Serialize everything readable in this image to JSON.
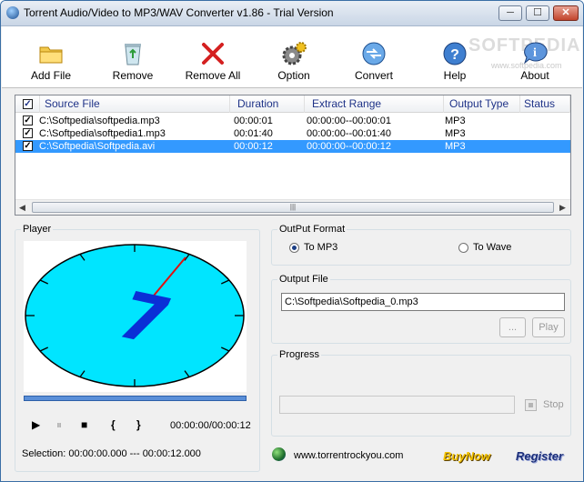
{
  "window": {
    "title": "Torrent Audio/Video to MP3/WAV Converter v1.86 - Trial Version",
    "min_label": "─",
    "max_label": "☐",
    "close_label": "✕"
  },
  "toolbar": {
    "buttons": [
      {
        "label": "Add File",
        "icon": "folder-icon"
      },
      {
        "label": "Remove",
        "icon": "recycle-bin-icon"
      },
      {
        "label": "Remove All",
        "icon": "red-x-icon"
      },
      {
        "label": "Option",
        "icon": "gear-icon"
      },
      {
        "label": "Convert",
        "icon": "convert-globe-icon"
      },
      {
        "label": "Help",
        "icon": "help-icon"
      },
      {
        "label": "About",
        "icon": "info-icon"
      }
    ],
    "watermark": "SOFTPEDIA",
    "watermark_url": "www.softpedia.com"
  },
  "file_list": {
    "columns": [
      "Source File",
      "Duration",
      "Extract Range",
      "Output Type",
      "Status"
    ],
    "rows": [
      {
        "source": "C:\\Softpedia\\softpedia.mp3",
        "duration": "00:00:01",
        "range": "00:00:00--00:00:01",
        "type": "MP3",
        "status": "",
        "checked": true,
        "selected": false
      },
      {
        "source": "C:\\Softpedia\\softpedia1.mp3",
        "duration": "00:01:40",
        "range": "00:00:00--00:01:40",
        "type": "MP3",
        "status": "",
        "checked": true,
        "selected": false
      },
      {
        "source": "C:\\Softpedia\\Softpedia.avi",
        "duration": "00:00:12",
        "range": "00:00:00--00:00:12",
        "type": "MP3",
        "status": "",
        "checked": true,
        "selected": true
      }
    ],
    "scroll_grip": "|||"
  },
  "player": {
    "title": "Player",
    "clock_digit": "7",
    "time": "00:00:00/00:00:12",
    "selection": "Selection: 00:00:00.000 --- 00:00:12.000",
    "controls": {
      "play": "▶",
      "pause": "⏸",
      "stop": "■",
      "mark_in": "{",
      "mark_out": "}"
    }
  },
  "output_format": {
    "title": "OutPut Format",
    "opt_mp3": "To MP3",
    "opt_wave": "To Wave",
    "selected": "mp3"
  },
  "output_file": {
    "title": "Output File",
    "value": "C:\\Softpedia\\Softpedia_0.mp3",
    "browse_label": "...",
    "play_label": "Play"
  },
  "progress": {
    "title": "Progress",
    "value": 0,
    "stop_label": "Stop"
  },
  "footer": {
    "website": "www.torrentrockyou.com",
    "buynow": "BuyNow",
    "register": "Register"
  },
  "colors": {
    "selection": "#3399ff",
    "clock_face": "#00e5ff",
    "clock_hand": "#e01010",
    "digit": "#0a2fd6"
  }
}
